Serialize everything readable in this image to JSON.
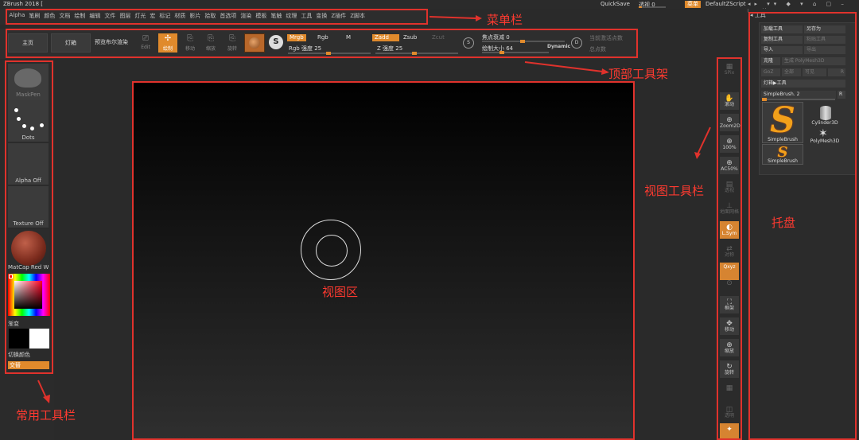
{
  "titlebar": {
    "app_title": "ZBrush 2018 [",
    "quicksave": "QuickSave",
    "perspective": "透视  0",
    "menu_button": "菜单",
    "script": "DefaultZScript",
    "window_icons": "◂▸ ▾▾ ◆ ▾ ⌂ ▢ – ◻ ✕"
  },
  "menubar": {
    "items": [
      "Alpha",
      "笔刷",
      "颜色",
      "文档",
      "绘制",
      "编辑",
      "文件",
      "图层",
      "灯光",
      "宏",
      "标记",
      "材质",
      "影片",
      "拾取",
      "首选项",
      "渲染",
      "模板",
      "笔触",
      "纹理",
      "工具",
      "变换",
      "Z插件",
      "Z脚本"
    ]
  },
  "shelf": {
    "home": "主页",
    "lightbox": "灯箱",
    "bpr": "预览布尔渲染",
    "edit": "Edit",
    "draw": "绘制",
    "move": "移动",
    "scale": "缩放",
    "rotate": "旋转",
    "mrgb": "Mrgb",
    "rgb": "Rgb",
    "m": "M",
    "zadd": "Zadd",
    "zsub": "Zsub",
    "zcut": "Zcut",
    "rgb_intensity": "Rgb 强度 25",
    "z_intensity": "Z 强度 25",
    "focal_shift": "焦点衰减 0",
    "draw_size": "绘制大小 64",
    "dynamic": "Dynamic",
    "active_points": "当前激活点数",
    "total_points": "总点数",
    "ring_s": "S",
    "ring_d": "D"
  },
  "leftshelf": {
    "brush_label": "MaskPen",
    "stroke_label": "Dots",
    "alpha_label": "Alpha Off",
    "texture_label": "Texture Off",
    "material_label": "MatCap Red Wa",
    "gradient_label": "渐变",
    "switch_color_label": "切换颜色",
    "alternate_label": "交替"
  },
  "viewbar": {
    "items": [
      {
        "label": "SPix",
        "glyph": "▦",
        "style": "dim"
      },
      {
        "label": "滚动",
        "glyph": "✋",
        "style": "normal"
      },
      {
        "label": "Zoom2D",
        "glyph": "⊕",
        "style": "normal"
      },
      {
        "label": "100%",
        "glyph": "⊕",
        "style": "normal"
      },
      {
        "label": "AC50%",
        "glyph": "⊕",
        "style": "normal"
      },
      {
        "label": "透视",
        "glyph": "▤",
        "style": "dim"
      },
      {
        "label": "地面网格",
        "glyph": "⊥",
        "style": "dim"
      },
      {
        "label": "L.Sym",
        "glyph": "◐",
        "style": "orange"
      },
      {
        "label": "对称",
        "glyph": "⇄",
        "style": "dim"
      },
      {
        "label": "Qxyz",
        "glyph": "",
        "style": "orange"
      },
      {
        "label": "",
        "glyph": "⊙",
        "style": "dim"
      },
      {
        "label": "框架",
        "glyph": "⛶",
        "style": "normal"
      },
      {
        "label": "移动",
        "glyph": "✥",
        "style": "normal"
      },
      {
        "label": "缩放",
        "glyph": "⊕",
        "style": "normal"
      },
      {
        "label": "旋转",
        "glyph": "↻",
        "style": "normal"
      },
      {
        "label": "",
        "glyph": "▦",
        "style": "dim"
      },
      {
        "label": "透明",
        "glyph": "◫",
        "style": "dim"
      },
      {
        "label": "",
        "glyph": "✦",
        "style": "orange"
      }
    ]
  },
  "tray": {
    "header": "工具",
    "load_tool": "加载工具",
    "save_as": "另存为",
    "copy_tool": "复制工具",
    "paste_tool": "粘贴工具",
    "import": "导入",
    "export": "导出",
    "clone": "克隆",
    "make_polymesh": "生成 PolyMesh3D",
    "goz": "GoZ",
    "all": "全部",
    "visible": "可见",
    "goz_count": "R",
    "lightbox_tools": "灯箱▶工具",
    "current_tool": "SimpleBrush. 2",
    "r_button": "R",
    "tool1": "SimpleBrush",
    "tool2": "Cylinder3D",
    "tool3": "PolyMesh3D",
    "tool4": "SimpleBrush",
    "s_glyph": "S"
  },
  "annotations": {
    "menubar": "菜单栏",
    "top_shelf": "顶部工具架",
    "view_toolbar": "视图工具栏",
    "tray": "托盘",
    "viewport": "视图区",
    "left_shelf": "常用工具栏"
  },
  "colors": {
    "accent": "#e08a2c",
    "annotation": "#e0322c"
  }
}
